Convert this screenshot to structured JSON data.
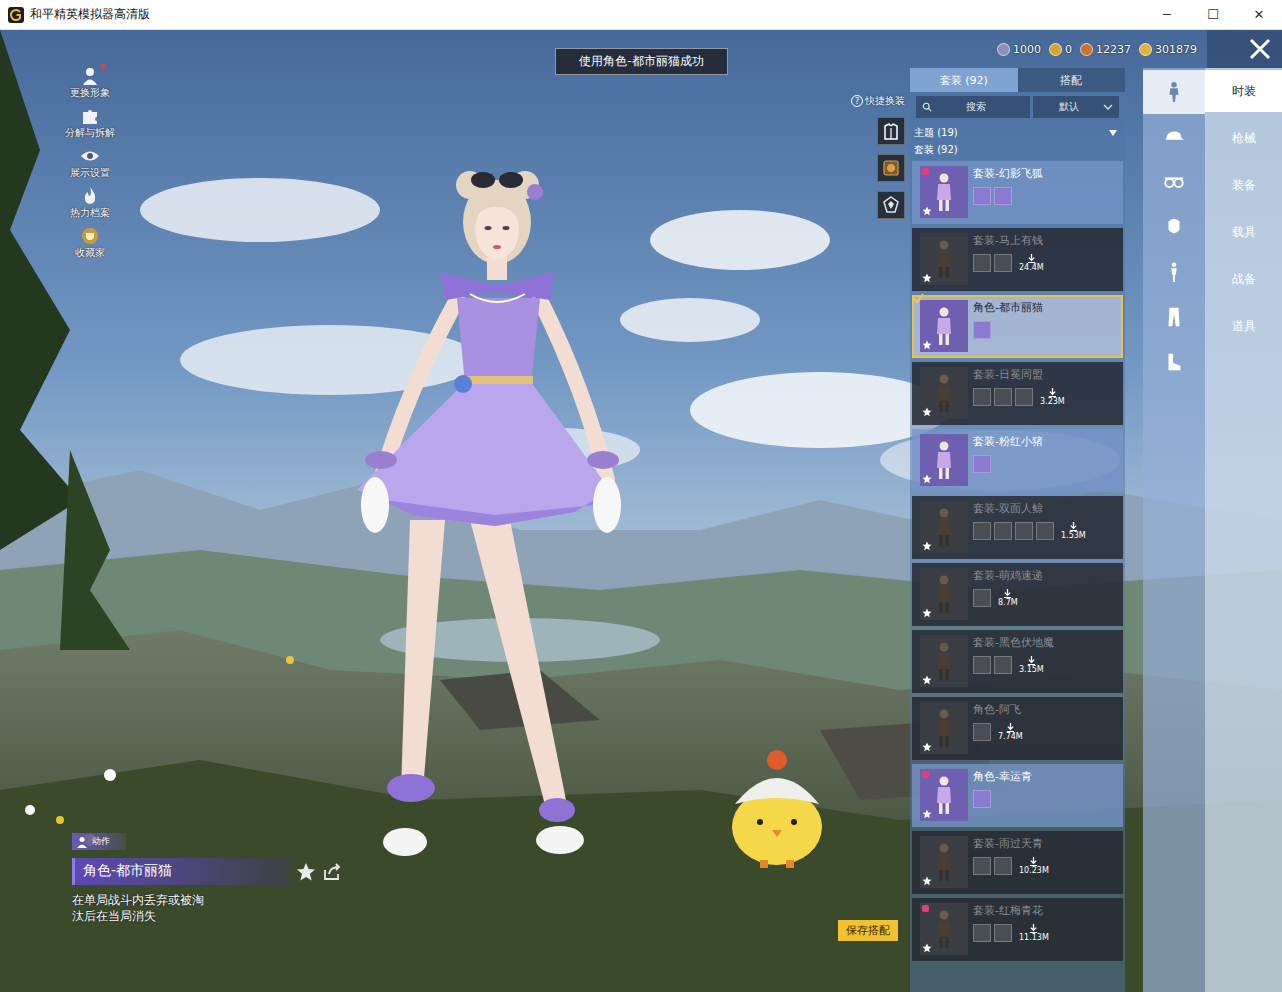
{
  "window": {
    "title": "和平精英模拟器高清版",
    "controls": [
      "─",
      "☐",
      "✕"
    ]
  },
  "toast": "使用角色-都市丽猫成功",
  "left_menu": [
    {
      "label": "更换形象",
      "kind": "person",
      "dot": true
    },
    {
      "label": "分解与拆解",
      "kind": "puzzle",
      "dot": false
    },
    {
      "label": "展示设置",
      "kind": "eye",
      "dot": false
    },
    {
      "label": "热力档案",
      "kind": "flame",
      "dot": false
    },
    {
      "label": "收藏家",
      "kind": "trophy",
      "dot": false
    }
  ],
  "currencies": [
    {
      "value": "1000",
      "color": "#8e8fb8"
    },
    {
      "value": "0",
      "color": "#d4a536"
    },
    {
      "value": "12237",
      "color": "#c7782e"
    },
    {
      "value": "301879",
      "color": "#e0b43c"
    }
  ],
  "quick_change": {
    "label": "快捷换装",
    "help": "?",
    "buttons": [
      "wardrobe",
      "emblem",
      "badge"
    ]
  },
  "panel": {
    "tabs": [
      {
        "label": "套装 (92)",
        "selected": true
      },
      {
        "label": "搭配",
        "selected": false
      }
    ],
    "search": {
      "placeholder": "搜索"
    },
    "sort": {
      "value": "默认"
    },
    "theme_header": "主题 (19)",
    "section_header": "套装 (92)",
    "items": [
      {
        "name": "套装-幻影飞狐",
        "owned": true,
        "selected": false,
        "badge": true,
        "parts": 2
      },
      {
        "name": "套装-马上有钱",
        "owned": false,
        "selected": false,
        "badge": false,
        "parts": 2,
        "size": "24.4M"
      },
      {
        "name": "角色-都市丽猫",
        "owned": true,
        "selected": true,
        "badge": false,
        "parts": 1
      },
      {
        "name": "套装-日冕同盟",
        "owned": false,
        "selected": false,
        "badge": false,
        "parts": 3,
        "size": "3.23M"
      },
      {
        "name": "套装-粉红小猪",
        "owned": true,
        "selected": false,
        "badge": false,
        "parts": 1
      },
      {
        "name": "套装-双面人鲸",
        "owned": false,
        "selected": false,
        "badge": false,
        "parts": 4,
        "size": "1.53M"
      },
      {
        "name": "套装-萌鸡速递",
        "owned": false,
        "selected": false,
        "badge": false,
        "parts": 1,
        "size": "8.7M"
      },
      {
        "name": "套装-黑色伏地魔",
        "owned": false,
        "selected": false,
        "badge": false,
        "parts": 2,
        "size": "3.15M"
      },
      {
        "name": "角色-阿飞",
        "owned": false,
        "selected": false,
        "badge": false,
        "parts": 1,
        "size": "7.74M"
      },
      {
        "name": "角色-幸运青",
        "owned": true,
        "selected": false,
        "badge": true,
        "parts": 1
      },
      {
        "name": "套装-雨过天青",
        "owned": false,
        "selected": false,
        "badge": false,
        "parts": 2,
        "size": "10.23M"
      },
      {
        "name": "套装-红梅青花",
        "owned": false,
        "selected": false,
        "badge": true,
        "parts": 2,
        "size": "11.13M"
      }
    ]
  },
  "nav_icons": [
    {
      "kind": "outfit",
      "selected": true
    },
    {
      "kind": "hat",
      "selected": false
    },
    {
      "kind": "glasses",
      "selected": false
    },
    {
      "kind": "face",
      "selected": false
    },
    {
      "kind": "figure",
      "selected": false
    },
    {
      "kind": "pants",
      "selected": false
    },
    {
      "kind": "shoes",
      "selected": false
    }
  ],
  "nav": [
    {
      "label": "时装",
      "selected": true
    },
    {
      "label": "枪械",
      "selected": false
    },
    {
      "label": "装备",
      "selected": false
    },
    {
      "label": "载具",
      "selected": false
    },
    {
      "label": "战备",
      "selected": false
    },
    {
      "label": "道具",
      "selected": false
    }
  ],
  "item_info": {
    "tag": "动作",
    "name": "角色-都市丽猫",
    "favorited": false,
    "description": "在单局战斗内丢弃或被淘汰后在当局消失"
  },
  "save_button": "保存搭配"
}
